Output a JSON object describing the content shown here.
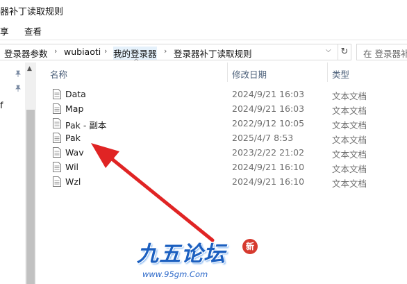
{
  "window": {
    "title": "器补丁读取规则"
  },
  "menu": {
    "items": [
      "享",
      "查看"
    ]
  },
  "address": {
    "crumbs": [
      "登录器参数",
      "wubiaoti",
      "我的登录器",
      "登录器补丁读取规则"
    ],
    "search_placeholder": "在 登录器补"
  },
  "nav": {
    "partial_label": "f"
  },
  "columns": {
    "name": "名称",
    "date": "修改日期",
    "type": "类型"
  },
  "files": [
    {
      "name": "Data",
      "date": "2024/9/21 16:03",
      "type": "文本文档"
    },
    {
      "name": "Map",
      "date": "2024/9/21 16:03",
      "type": "文本文档"
    },
    {
      "name": "Pak - 副本",
      "date": "2022/9/12 10:05",
      "type": "文本文档"
    },
    {
      "name": "Pak",
      "date": "2025/4/7 8:53",
      "type": "文本文档"
    },
    {
      "name": "Wav",
      "date": "2023/2/22 21:02",
      "type": "文本文档"
    },
    {
      "name": "Wil",
      "date": "2024/9/21 16:10",
      "type": "文本文档"
    },
    {
      "name": "Wzl",
      "date": "2024/9/21 16:10",
      "type": "文本文档"
    }
  ],
  "watermark": {
    "title": "九五论坛",
    "url": "www.95gm.Com",
    "badge": "新"
  },
  "colors": {
    "arrow": "#e02424",
    "header_text": "#4c607a",
    "watermark": "#1b5fc0"
  }
}
